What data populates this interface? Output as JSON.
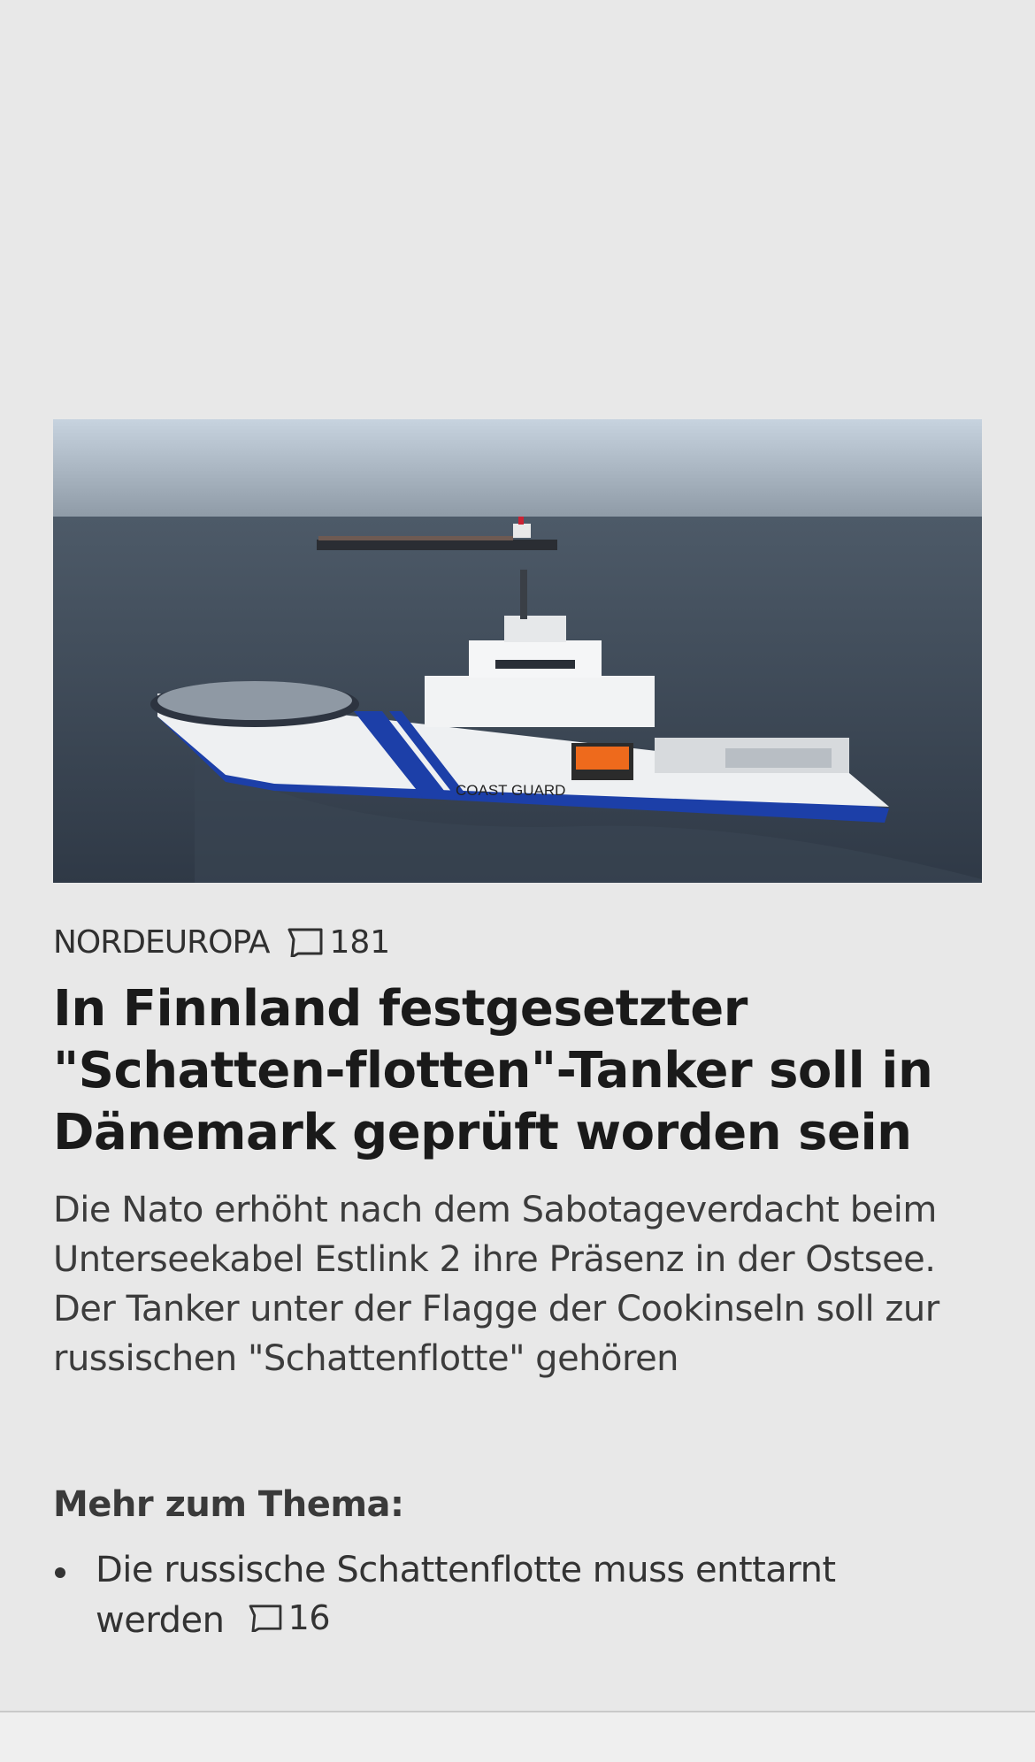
{
  "article": {
    "image": {
      "alt": "COAST GUARD",
      "hull_text": "COAST GUARD",
      "colors": {
        "sky": "#b9c7d6",
        "sea": "#3f4b58",
        "hull": "#eef0f2",
        "stripe": "#1c3fa8"
      }
    },
    "kicker": "NORDEUROPA",
    "comment_count": "181",
    "headline": "In Finnland festgesetzter \"Schatten-flotten\"-Tanker soll in Dänemark geprüft worden sein",
    "lead": "Die Nato erhöht nach dem Sabotageverdacht beim Unterseekabel Estlink 2 ihre Präsenz in der Ostsee. Der Tanker unter der Flagge der Cookinseln soll zur russischen \"Schattenflotte\" gehören"
  },
  "more": {
    "heading": "Mehr zum Thema:",
    "items": [
      {
        "text": "Die russische Schattenflotte muss enttarnt werden",
        "comment_count": "16"
      }
    ]
  },
  "icons": {
    "comment": "comment-icon"
  }
}
